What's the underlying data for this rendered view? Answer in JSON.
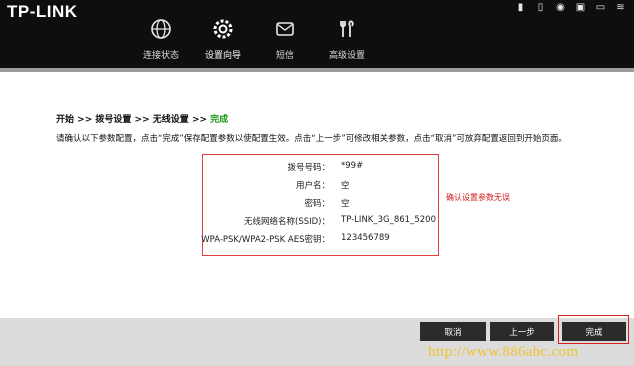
{
  "header": {
    "logo": "TP-LINK",
    "nav": [
      {
        "label": "连接状态",
        "icon": "globe-icon"
      },
      {
        "label": "设置向导",
        "icon": "gear-icon",
        "active": true
      },
      {
        "label": "短信",
        "icon": "envelope-icon"
      },
      {
        "label": "高级设置",
        "icon": "tools-icon"
      }
    ],
    "status_icons": [
      "signal-icon",
      "sim-icon",
      "lock-icon",
      "sms-icon",
      "battery-icon",
      "wifi-icon"
    ]
  },
  "breadcrumb": {
    "step1": "开始",
    "step2": "拨号设置",
    "step3": "无线设置",
    "step4": "完成",
    "sep": ">>"
  },
  "instruction": "请确认以下参数配置，点击“完成”保存配置参数以使配置生效。点击“上一步”可修改相关参数，点击“取消”可放弃配置返回到开始页面。",
  "summary": [
    {
      "key": "拨号号码：",
      "value": "*99#"
    },
    {
      "key": "用户名：",
      "value": "空"
    },
    {
      "key": "密码：",
      "value": "空"
    },
    {
      "key": "无线网络名称(SSID)：",
      "value": "TP-LINK_3G_861_5200"
    },
    {
      "key": "WPA-PSK/WPA2-PSK AES密钥：",
      "value": "123456789"
    }
  ],
  "note": "确认设置参数无误",
  "buttons": {
    "cancel": "取消",
    "prev": "上一步",
    "finish": "完成"
  },
  "watermark": "http://www.886abc.com",
  "colors": {
    "accent_red": "#d42020",
    "done_green": "#1a9a1a",
    "watermark": "#f2c230"
  }
}
